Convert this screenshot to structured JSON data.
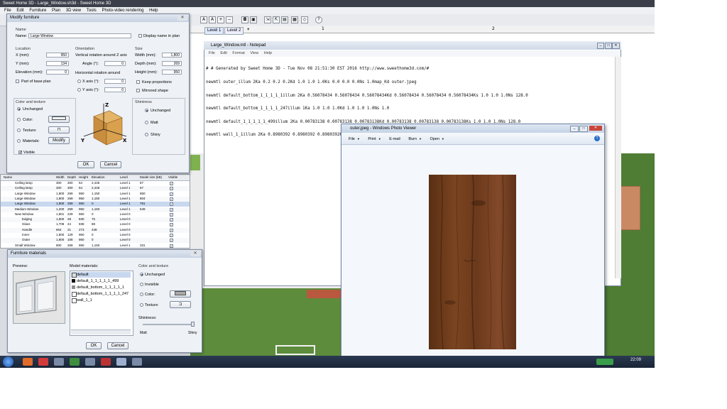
{
  "app": {
    "title": "Sweet Home 3D - Large_Window.sh3d - Sweet Home 3D",
    "menu": [
      "File",
      "Edit",
      "Furniture",
      "Plan",
      "3D view",
      "Tools",
      "Photo-video rendering",
      "Help"
    ],
    "levels": [
      "Level 1",
      "Level 2"
    ],
    "add_level": "+",
    "ruler": [
      "1",
      "2"
    ],
    "clock": "22:09"
  },
  "modify_furniture": {
    "title": "Modify furniture",
    "name_section": "Name",
    "name_label": "Name:",
    "name_value": "Large Window",
    "display_name": "Display name in plan",
    "location_section": "Location",
    "x_label": "X (mm):",
    "x_value": "950",
    "y_label": "Y (mm):",
    "y_value": "134",
    "elev_label": "Elevation (mm):",
    "elev_value": "0",
    "base_plan": "Part of base plan",
    "orientation_section": "Orientation",
    "vert_rot": "Vertical rotation around Z axis",
    "angle_label": "Angle (°):",
    "angle_value": "0",
    "horiz_rot": "Horizontal rotation around",
    "xaxis_label": "X axis (°):",
    "xaxis_value": "0",
    "yaxis_label": "Y axis (°):",
    "yaxis_value": "0",
    "size_section": "Size",
    "width_label": "Width (mm):",
    "width_value": "1,800",
    "depth_label": "Depth (mm):",
    "depth_value": "269",
    "height_label": "Height (mm):",
    "height_value": "950",
    "keep_prop": "Keep proportions",
    "mirrored": "Mirrored shape",
    "color_section": "Color and texture",
    "unchanged": "Unchanged",
    "color": "Color:",
    "texture": "Texture:",
    "materials": "Materials:",
    "modify_btn": "Modify",
    "shininess_section": "Shininess",
    "sh_unchanged": "Unchanged",
    "sh_matt": "Matt",
    "sh_shiny": "Shiny",
    "visible": "Visible",
    "ok": "OK",
    "cancel": "Cancel"
  },
  "furniture_table": {
    "headers": [
      "Name",
      "Width",
      "Depth",
      "Height",
      "Elevation",
      "Level",
      "Model size (kB)",
      "Visible"
    ],
    "rows": [
      [
        "Ceiling lamp",
        "300",
        "300",
        "54",
        "2,446",
        "Level 1",
        "67"
      ],
      [
        "Ceiling lamp",
        "300",
        "300",
        "54",
        "2,446",
        "Level 1",
        "67"
      ],
      [
        "Large Window",
        "1,800",
        "269",
        "950",
        "1,150",
        "Level 1",
        "850"
      ],
      [
        "Large Window",
        "1,800",
        "269",
        "950",
        "1,150",
        "Level 1",
        "804"
      ],
      [
        "Large Window",
        "1,800",
        "269",
        "950",
        "0",
        "Level 1",
        "791"
      ],
      [
        "Medium Window",
        "1,200",
        "269",
        "950",
        "1,150",
        "Level 1",
        "549"
      ],
      [
        "New Window",
        "1,801",
        "229",
        "960",
        "0",
        "Level 0",
        ""
      ],
      [
        "Edging",
        "1,800",
        "28",
        "830",
        "75",
        "Level 0",
        ""
      ],
      [
        "Glass",
        "1,708",
        "24",
        "838",
        "88",
        "Level 0",
        ""
      ],
      [
        "Handle",
        "664",
        "21",
        "273",
        "448",
        "Level 0",
        ""
      ],
      [
        "Inner",
        "1,800",
        "129",
        "960",
        "0",
        "Level 0",
        ""
      ],
      [
        "Outer",
        "1,800",
        "108",
        "960",
        "0",
        "Level 0",
        ""
      ],
      [
        "Small Window",
        "800",
        "269",
        "950",
        "1,150",
        "Level 1",
        "331"
      ]
    ]
  },
  "materials_dialog": {
    "title": "Furniture materials",
    "preview": "Preview:",
    "model_materials": "Model materials:",
    "items": [
      "default",
      "default_1_1_1_1_1_499",
      "default_bottom_1_1_1_1_1",
      "default_bottom_1_1_1_1_247",
      "wall_1_1"
    ],
    "color_section": "Color and texture",
    "unchanged": "Unchanged",
    "invisible": "Invisible",
    "color": "Color:",
    "texture": "Texture:",
    "shininess": "Shininess:",
    "matt": "Matt",
    "shiny": "Shiny",
    "ok": "OK",
    "cancel": "Cancel"
  },
  "notepad": {
    "title": "Large_Window.mtl - Notepad",
    "menu": [
      "File",
      "Edit",
      "Format",
      "View",
      "Help"
    ],
    "lines": [
      "# # Generated by Sweet Home 3D - Tue Nov 08 21:51:30 EST 2016 http://www.sweethome3d.com/#",
      "newmtl outer_illum 2Ka 0.2 0.2 0.2Kd 1.0 1.0 1.0Ks 0.0 0.0 0.0Ns 1.0map_Kd outer.jpeg",
      "newmtl default_bottom_1_1_1_1_1illum 2Ka 0.56078434 0.56078434 0.56078434Kd 0.56078434 0.56078434 0.56078434Ks 1.0 1.0 1.0Ns 128.0",
      "newmtl default_bottom_1_1_1_1_247illum 1Ka 1.0 1.0 1.0Kd 1.0 1.0 1.0Ns 1.0",
      "newmtl default_1_1_1_1_1_499illum 2Ka 0.00783138 0.00783138 0.00783138Kd 0.00783138 0.00783138 0.00783138Ks 1.0 1.0 1.0Ns 128.0",
      "newmtl wall_1_1illum 2Ka 0.8980392 0.8980392 0.8980392Kd 0.8980392 0.8980392 0.8980392Ks 1.0 1.0 1.0Ns 128.0d 1.0d 0.14117646"
    ]
  },
  "photo_viewer": {
    "title": "outer.jpeg - Windows Photo Viewer",
    "menu": [
      "File",
      "Print",
      "E-mail",
      "Burn",
      "Open"
    ],
    "help": "?"
  },
  "colors": {
    "taskbar": "#1a2436",
    "wood": "#6b3a1c",
    "grass": "#5d8c3c"
  }
}
